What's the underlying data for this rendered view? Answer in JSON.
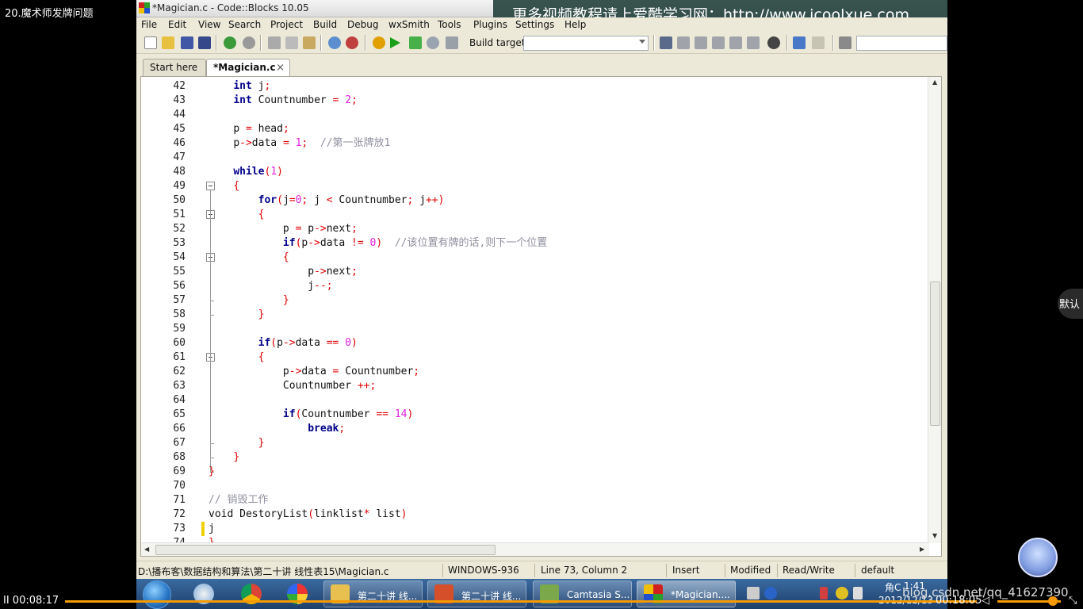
{
  "player": {
    "title": "20.魔术师发牌问题",
    "time_current": "II 00:08:17",
    "time_total": "00:18:05",
    "watermark_csdn": "blog.csdn.net/qq_41627390",
    "side_button": "默认"
  },
  "window": {
    "title": "*Magician.c - Code::Blocks 10.05",
    "watermark": "更多视频教程请上爱酷学习网：http://www.icoolxue.com"
  },
  "menu": [
    "File",
    "Edit",
    "View",
    "Search",
    "Project",
    "Build",
    "Debug",
    "wxSmith",
    "Tools",
    "Plugins",
    "Settings",
    "Help"
  ],
  "toolbar": {
    "build_target_label": "Build target:",
    "build_target_value": ""
  },
  "tabs": [
    {
      "label": "Start here",
      "active": false
    },
    {
      "label": "*Magician.c",
      "active": true
    }
  ],
  "editor": {
    "current_line": 73,
    "lines": [
      {
        "n": "42",
        "tokens": [
          [
            "",
            "    "
          ],
          [
            "kw",
            "int"
          ],
          [
            "tx",
            " j"
          ],
          [
            "op",
            ";"
          ]
        ]
      },
      {
        "n": "43",
        "tokens": [
          [
            "",
            "    "
          ],
          [
            "kw",
            "int"
          ],
          [
            "tx",
            " Countnumber "
          ],
          [
            "op",
            "="
          ],
          [
            "tx",
            " "
          ],
          [
            "num",
            "2"
          ],
          [
            "op",
            ";"
          ]
        ]
      },
      {
        "n": "44",
        "tokens": []
      },
      {
        "n": "45",
        "tokens": [
          [
            "",
            "    "
          ],
          [
            "tx",
            "p "
          ],
          [
            "op",
            "="
          ],
          [
            "tx",
            " head"
          ],
          [
            "op",
            ";"
          ]
        ]
      },
      {
        "n": "46",
        "tokens": [
          [
            "",
            "    "
          ],
          [
            "tx",
            "p"
          ],
          [
            "op",
            "->"
          ],
          [
            "tx",
            "data "
          ],
          [
            "op",
            "="
          ],
          [
            "tx",
            " "
          ],
          [
            "num",
            "1"
          ],
          [
            "op",
            ";"
          ],
          [
            "tx",
            "  "
          ],
          [
            "cm",
            "//第一张牌放1"
          ]
        ]
      },
      {
        "n": "47",
        "tokens": []
      },
      {
        "n": "48",
        "tokens": [
          [
            "",
            "    "
          ],
          [
            "kw",
            "while"
          ],
          [
            "op",
            "("
          ],
          [
            "num",
            "1"
          ],
          [
            "op",
            ")"
          ]
        ]
      },
      {
        "n": "49",
        "tokens": [
          [
            "",
            "    "
          ],
          [
            "op",
            "{"
          ]
        ]
      },
      {
        "n": "50",
        "tokens": [
          [
            "",
            "        "
          ],
          [
            "kw",
            "for"
          ],
          [
            "op",
            "("
          ],
          [
            "tx",
            "j"
          ],
          [
            "op",
            "="
          ],
          [
            "num",
            "0"
          ],
          [
            "op",
            ";"
          ],
          [
            "tx",
            " j "
          ],
          [
            "op",
            "<"
          ],
          [
            "tx",
            " Countnumber"
          ],
          [
            "op",
            ";"
          ],
          [
            "tx",
            " j"
          ],
          [
            "op",
            "++)"
          ]
        ]
      },
      {
        "n": "51",
        "tokens": [
          [
            "",
            "        "
          ],
          [
            "op",
            "{"
          ]
        ]
      },
      {
        "n": "52",
        "tokens": [
          [
            "",
            "            "
          ],
          [
            "tx",
            "p "
          ],
          [
            "op",
            "="
          ],
          [
            "tx",
            " p"
          ],
          [
            "op",
            "->"
          ],
          [
            "tx",
            "next"
          ],
          [
            "op",
            ";"
          ]
        ]
      },
      {
        "n": "53",
        "tokens": [
          [
            "",
            "            "
          ],
          [
            "kw",
            "if"
          ],
          [
            "op",
            "("
          ],
          [
            "tx",
            "p"
          ],
          [
            "op",
            "->"
          ],
          [
            "tx",
            "data "
          ],
          [
            "op",
            "!="
          ],
          [
            "tx",
            " "
          ],
          [
            "num",
            "0"
          ],
          [
            "op",
            ")"
          ],
          [
            "tx",
            "  "
          ],
          [
            "cm",
            "//该位置有牌的话,则下一个位置"
          ]
        ]
      },
      {
        "n": "54",
        "tokens": [
          [
            "",
            "            "
          ],
          [
            "op",
            "{"
          ]
        ]
      },
      {
        "n": "55",
        "tokens": [
          [
            "",
            "                "
          ],
          [
            "tx",
            "p"
          ],
          [
            "op",
            "->"
          ],
          [
            "tx",
            "next"
          ],
          [
            "op",
            ";"
          ]
        ]
      },
      {
        "n": "56",
        "tokens": [
          [
            "",
            "                "
          ],
          [
            "tx",
            "j"
          ],
          [
            "op",
            "--;"
          ]
        ]
      },
      {
        "n": "57",
        "tokens": [
          [
            "",
            "            "
          ],
          [
            "op",
            "}"
          ]
        ]
      },
      {
        "n": "58",
        "tokens": [
          [
            "",
            "        "
          ],
          [
            "op",
            "}"
          ]
        ]
      },
      {
        "n": "59",
        "tokens": []
      },
      {
        "n": "60",
        "tokens": [
          [
            "",
            "        "
          ],
          [
            "kw",
            "if"
          ],
          [
            "op",
            "("
          ],
          [
            "tx",
            "p"
          ],
          [
            "op",
            "->"
          ],
          [
            "tx",
            "data "
          ],
          [
            "op",
            "=="
          ],
          [
            "tx",
            " "
          ],
          [
            "num",
            "0"
          ],
          [
            "op",
            ")"
          ]
        ]
      },
      {
        "n": "61",
        "tokens": [
          [
            "",
            "        "
          ],
          [
            "op",
            "{"
          ]
        ]
      },
      {
        "n": "62",
        "tokens": [
          [
            "",
            "            "
          ],
          [
            "tx",
            "p"
          ],
          [
            "op",
            "->"
          ],
          [
            "tx",
            "data "
          ],
          [
            "op",
            "="
          ],
          [
            "tx",
            " Countnumber"
          ],
          [
            "op",
            ";"
          ]
        ]
      },
      {
        "n": "63",
        "tokens": [
          [
            "",
            "            "
          ],
          [
            "tx",
            "Countnumber "
          ],
          [
            "op",
            "++;"
          ]
        ]
      },
      {
        "n": "64",
        "tokens": []
      },
      {
        "n": "65",
        "tokens": [
          [
            "",
            "            "
          ],
          [
            "kw",
            "if"
          ],
          [
            "op",
            "("
          ],
          [
            "tx",
            "Countnumber "
          ],
          [
            "op",
            "=="
          ],
          [
            "tx",
            " "
          ],
          [
            "num",
            "14"
          ],
          [
            "op",
            ")"
          ]
        ]
      },
      {
        "n": "66",
        "tokens": [
          [
            "",
            "                "
          ],
          [
            "kw",
            "break"
          ],
          [
            "op",
            ";"
          ]
        ]
      },
      {
        "n": "67",
        "tokens": [
          [
            "",
            "        "
          ],
          [
            "op",
            "}"
          ]
        ]
      },
      {
        "n": "68",
        "tokens": [
          [
            "",
            "    "
          ],
          [
            "op",
            "}"
          ]
        ]
      },
      {
        "n": "69",
        "tokens": [
          [
            "op",
            "}"
          ]
        ]
      },
      {
        "n": "70",
        "tokens": []
      },
      {
        "n": "71",
        "tokens": [
          [
            "cm",
            "// 销毁工作"
          ]
        ]
      },
      {
        "n": "72",
        "tokens": [
          [
            "tx",
            "void DestoryList"
          ],
          [
            "op",
            "("
          ],
          [
            "tx",
            "linklist"
          ],
          [
            "op",
            "*"
          ],
          [
            "tx",
            " list"
          ],
          [
            "op",
            ")"
          ]
        ]
      },
      {
        "n": "73",
        "tokens": [
          [
            "tx",
            "j"
          ]
        ]
      },
      {
        "n": "74",
        "tokens": [
          [
            "op",
            "}"
          ]
        ]
      }
    ]
  },
  "status": {
    "path": "D:\\播布客\\数据结构和算法\\第二十讲 线性表15\\Magician.c",
    "encoding": "WINDOWS-936",
    "position": "Line 73, Column 2",
    "mode": "Insert",
    "modified": "Modified",
    "access": "Read/Write",
    "profile": "default"
  },
  "taskbar": {
    "buttons": [
      {
        "label": "第二十讲 线...",
        "icon": "folder-icon"
      },
      {
        "label": "第二十讲 线...",
        "icon": "powerpoint-icon"
      },
      {
        "label": "Camtasia S...",
        "icon": "camtasia-icon"
      },
      {
        "label": "*Magician....",
        "icon": "codeblocks-icon"
      }
    ],
    "clock": "1:41",
    "ime": "角C",
    "date": "2012/12/13"
  }
}
